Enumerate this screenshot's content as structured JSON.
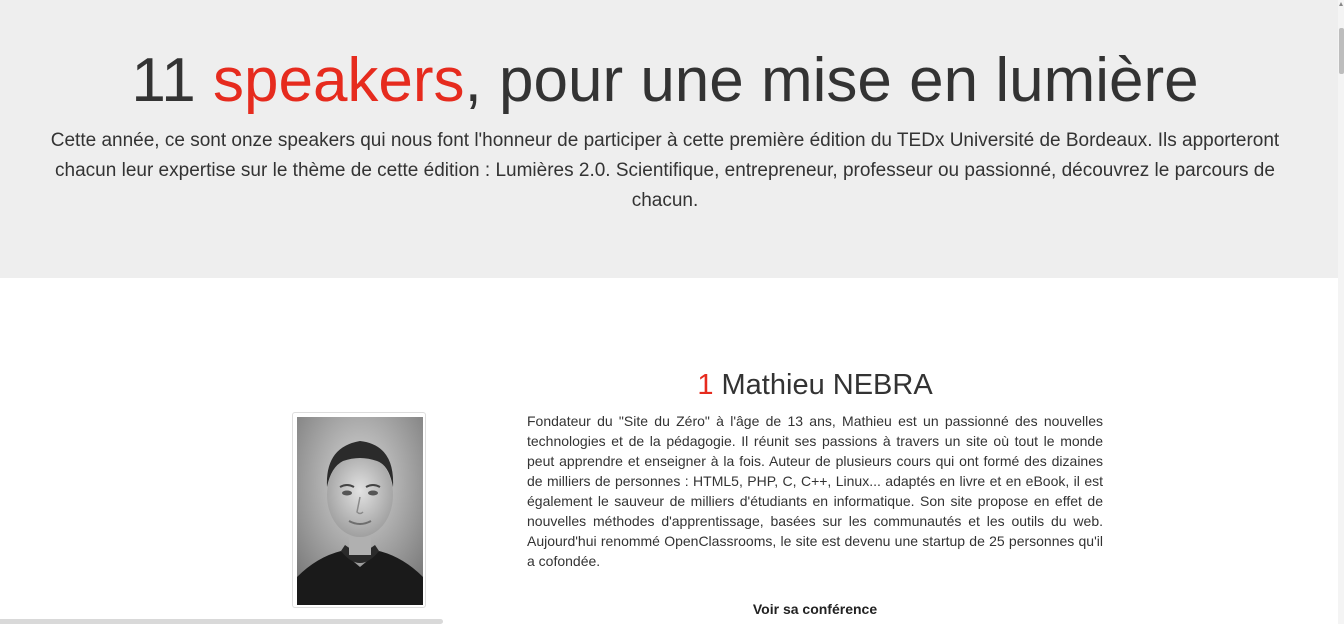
{
  "hero": {
    "title_prefix": "11 ",
    "title_accent": "speakers",
    "title_suffix": ", pour une mise en lumière",
    "intro": "Cette année, ce sont onze speakers qui nous font l'honneur de participer à cette première édition du TEDx Université de Bordeaux. Ils apporteront chacun leur expertise sur le thème de cette édition : Lumières 2.0. Scientifique, entrepreneur, professeur ou passionné, découvrez le parcours de chacun."
  },
  "speaker": {
    "number": "1",
    "name": " Mathieu NEBRA",
    "bio": "Fondateur du \"Site du Zéro\" à l'âge de 13 ans, Mathieu est un passionné des nouvelles technologies et de la pédagogie. Il réunit ses passions à travers un site où tout le monde peut apprendre et enseigner à la fois. Auteur de plusieurs cours qui ont formé des dizaines de milliers de personnes : HTML5, PHP, C, C++, Linux... adaptés en livre et en eBook, il est également le sauveur de milliers d'étudiants en informatique. Son site propose en effet de nouvelles méthodes d'apprentissage, basées sur les communautés et les outils du web. Aujourd'hui renommé OpenClassrooms, le site est devenu une startup de 25 personnes qu'il a cofondée.",
    "conference_link": "Voir sa conférence",
    "photo": "speaker-portrait"
  },
  "colors": {
    "accent": "#e62b1e",
    "hero_background": "#eeeeee",
    "text": "#333333"
  }
}
